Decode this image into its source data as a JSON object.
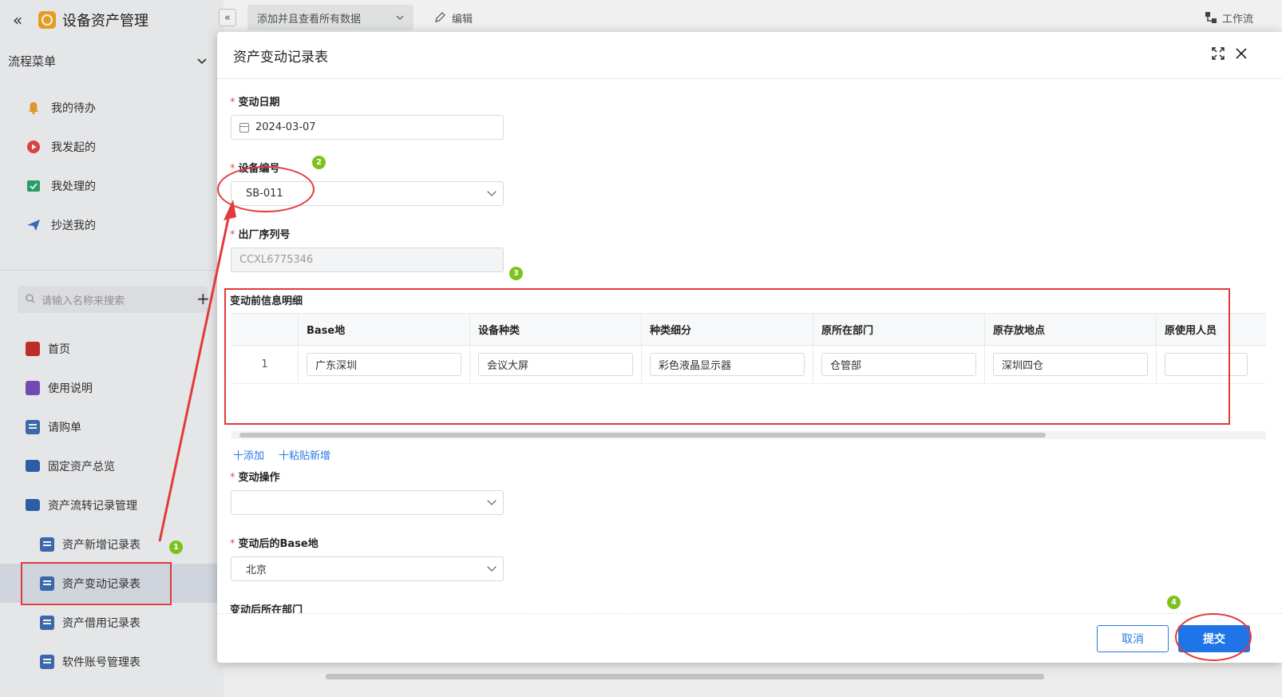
{
  "app": {
    "title": "设备资产管理"
  },
  "flow_menu": {
    "title": "流程菜单",
    "items": [
      {
        "label": "我的待办",
        "icon": "bell-icon",
        "color": "#f0a030"
      },
      {
        "label": "我发起的",
        "icon": "play-circle-icon",
        "color": "#e84646"
      },
      {
        "label": "我处理的",
        "icon": "check-box-icon",
        "color": "#2aa86b"
      },
      {
        "label": "抄送我的",
        "icon": "send-icon",
        "color": "#3a6fc8"
      }
    ]
  },
  "search": {
    "placeholder": "请输入名称来搜索"
  },
  "nav": {
    "items": [
      {
        "label": "首页",
        "icon": "home-icon"
      },
      {
        "label": "使用说明",
        "icon": "guide-icon"
      },
      {
        "label": "请购单",
        "icon": "document-icon"
      },
      {
        "label": "固定资产总览",
        "icon": "folder-icon"
      },
      {
        "label": "资产流转记录管理",
        "icon": "folder-open-icon"
      },
      {
        "label": "资产新增记录表",
        "icon": "document-icon"
      },
      {
        "label": "资产变动记录表",
        "icon": "document-icon"
      },
      {
        "label": "资产借用记录表",
        "icon": "document-icon"
      },
      {
        "label": "软件账号管理表",
        "icon": "document-icon"
      }
    ]
  },
  "topbar": {
    "view_label": "添加并且查看所有数据",
    "edit_label": "编辑",
    "workflow_label": "工作流"
  },
  "modal": {
    "title": "资产变动记录表",
    "fields": {
      "change_date": {
        "label": "变动日期",
        "value": "2024-03-07"
      },
      "device_no": {
        "label": "设备编号",
        "value": "SB-011"
      },
      "serial_no": {
        "label": "出厂序列号",
        "value": "CCXL6775346"
      },
      "sub_title": "变动前信息明细",
      "change_op": {
        "label": "变动操作",
        "value": ""
      },
      "new_base": {
        "label": "变动后的Base地",
        "value": "北京"
      },
      "new_dept": {
        "label": "变动后所在部门",
        "value": ""
      }
    },
    "table": {
      "columns": [
        "Base地",
        "设备种类",
        "种类细分",
        "原所在部门",
        "原存放地点",
        "原使用人员"
      ],
      "rows": [
        {
          "index": "1",
          "cells": [
            "广东深圳",
            "会议大屏",
            "彩色液晶显示器",
            "仓管部",
            "深圳四仓",
            ""
          ]
        }
      ],
      "add_label": "十添加",
      "paste_label": "十粘贴新增"
    },
    "cancel_label": "取消",
    "submit_label": "提交"
  },
  "annotations": {
    "color": "#e23a3a",
    "badge_color": "#7cc21c",
    "badges": [
      "1",
      "2",
      "3",
      "4"
    ]
  }
}
